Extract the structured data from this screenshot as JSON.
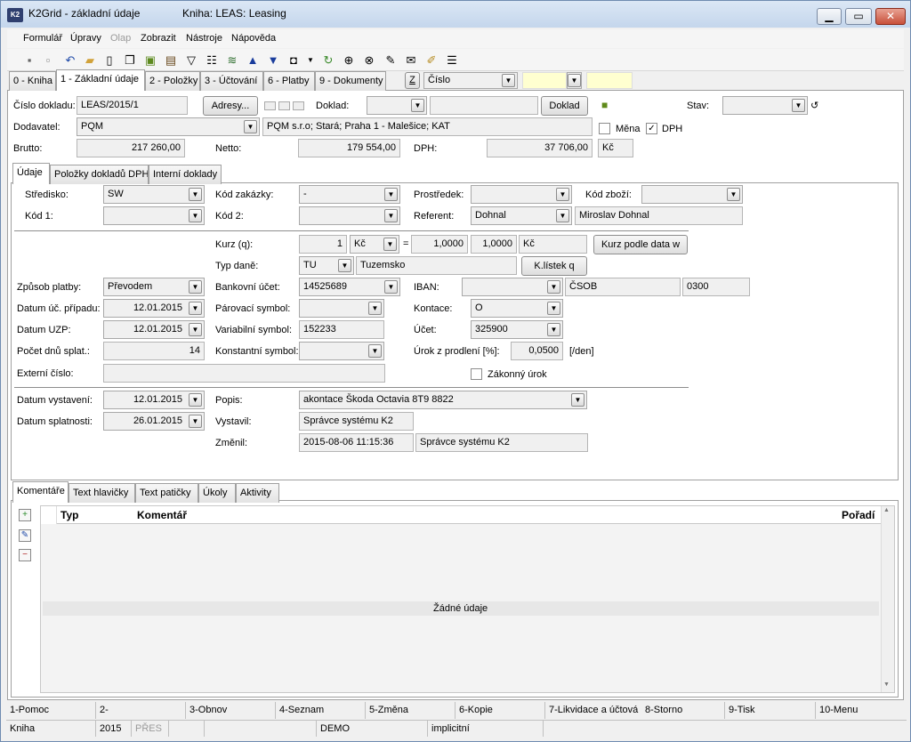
{
  "window": {
    "title": "K2Grid - základní údaje",
    "book": "Kniha: LEAS: Leasing",
    "minimize": "▁",
    "restore": "▭",
    "close": "✕"
  },
  "menu": [
    "Formulář",
    "Úpravy",
    "Olap",
    "Zobrazit",
    "Nástroje",
    "Nápověda"
  ],
  "toolbar_icons": [
    "save-icon",
    "save-as-icon",
    "undo-icon",
    "open-folder-icon",
    "new-document-icon",
    "copy-icon",
    "lock-icon",
    "book-icon",
    "filter-icon",
    "filter-list-icon",
    "layers-icon",
    "arrow-up-icon",
    "arrow-down-icon",
    "camera-icon",
    "dropdown-icon",
    "refresh-icon",
    "binoculars-icon",
    "find-next-icon",
    "tools-icon",
    "mail-icon",
    "edit-icon",
    "menu-lines-icon"
  ],
  "tabs": [
    "0 - Kniha",
    "1 - Základní údaje",
    "2 - Položky",
    "3 - Účtování",
    "6 - Platby",
    "9 - Dokumenty"
  ],
  "sort": {
    "key": "Z",
    "value": "Číslo"
  },
  "header": {
    "cislo_dokladu_label": "Číslo dokladu:",
    "cislo_dokladu": "LEAS/2015/1",
    "adresy_button": "Adresy...",
    "doklad_label": "Doklad:",
    "doklad_button": "Doklad",
    "stav_label": "Stav:",
    "dodavatel_label": "Dodavatel:",
    "dodavatel": "PQM",
    "dodavatel_name": "PQM s.r.o; Stará; Praha 1 - Malešice; KAT",
    "mena_label": "Měna",
    "dph_check_label": "DPH",
    "brutto_label": "Brutto:",
    "brutto": "217 260,00",
    "netto_label": "Netto:",
    "netto": "179 554,00",
    "dph_label": "DPH:",
    "dph": "37 706,00",
    "currency": "Kč"
  },
  "subtabs": [
    "Údaje",
    "Položky dokladů DPH",
    "Interní doklady"
  ],
  "udaje": {
    "stredisko_label": "Středisko:",
    "stredisko": "SW",
    "kod_zakazky_label": "Kód zakázky:",
    "kod_zakazky": "-",
    "prostredek_label": "Prostředek:",
    "kod_zbozi_label": "Kód zboží:",
    "kod1_label": "Kód 1:",
    "kod2_label": "Kód 2:",
    "referent_label": "Referent:",
    "referent": "Dohnal",
    "referent_name": "Miroslav Dohnal",
    "kurz_label": "Kurz (q):",
    "kurz_mnozstvi": "1",
    "kurz_mena": "Kč",
    "kurz_eq": "=",
    "kurz_1": "1,0000",
    "kurz_2": "1,0000",
    "kurz_mena2": "Kč",
    "kurz_button": "Kurz podle data w",
    "typ_dane_label": "Typ daně:",
    "typ_dane": "TU",
    "typ_dane_name": "Tuzemsko",
    "klistek_button": "K.lístek q",
    "zpusob_platby_label": "Způsob platby:",
    "zpusob_platby": "Převodem",
    "bankovni_ucet_label": "Bankovní účet:",
    "bankovni_ucet": "14525689",
    "iban_label": "IBAN:",
    "banka": "ČSOB",
    "kod_banky": "0300",
    "datum_uc_label": "Datum úč. případu:",
    "datum_uc": "12.01.2015",
    "parovaci_label": "Párovací symbol:",
    "kontace_label": "Kontace:",
    "kontace": "O",
    "datum_uzp_label": "Datum UZP:",
    "datum_uzp": "12.01.2015",
    "variabilni_label": "Variabilní symbol:",
    "variabilni": "152233",
    "ucet_label": "Účet:",
    "ucet": "325900",
    "pocet_dnu_label": "Počet dnů splat.:",
    "pocet_dnu": "14",
    "konstantni_label": "Konstantní symbol:",
    "urok_label": "Úrok z prodlení [%]:",
    "urok": "0,0500",
    "urok_unit": "[/den]",
    "externi_label": "Externí číslo:",
    "zakonny_urok_label": "Zákonný úrok",
    "datum_vystaveni_label": "Datum vystavení:",
    "datum_vystaveni": "12.01.2015",
    "datum_splatnosti_label": "Datum splatnosti:",
    "datum_splatnosti": "26.01.2015",
    "popis_label": "Popis:",
    "popis": "akontace Škoda Octavia 8T9 8822",
    "vystavil_label": "Vystavil:",
    "vystavil": "Správce systému K2",
    "zmenil_label": "Změnil:",
    "zmenil_datum": "2015-08-06 11:15:36",
    "zmenil": "Správce systému K2"
  },
  "bottom_tabs": [
    "Komentáře",
    "Text hlavičky",
    "Text patičky",
    "Úkoly",
    "Aktivity"
  ],
  "grid": {
    "columns": [
      "Typ",
      "Komentář",
      "Pořadí"
    ],
    "empty": "Žádné údaje"
  },
  "fkeys": [
    "1-Pomoc",
    "2-",
    "3-Obnov",
    "4-Seznam",
    "5-Změna",
    "6-Kopie",
    "7-Likvidace a účtová",
    "8-Storno",
    "9-Tisk",
    "10-Menu"
  ],
  "status": [
    "Kniha",
    "2015",
    "PŘES",
    "",
    "DEMO",
    "implicitní"
  ]
}
